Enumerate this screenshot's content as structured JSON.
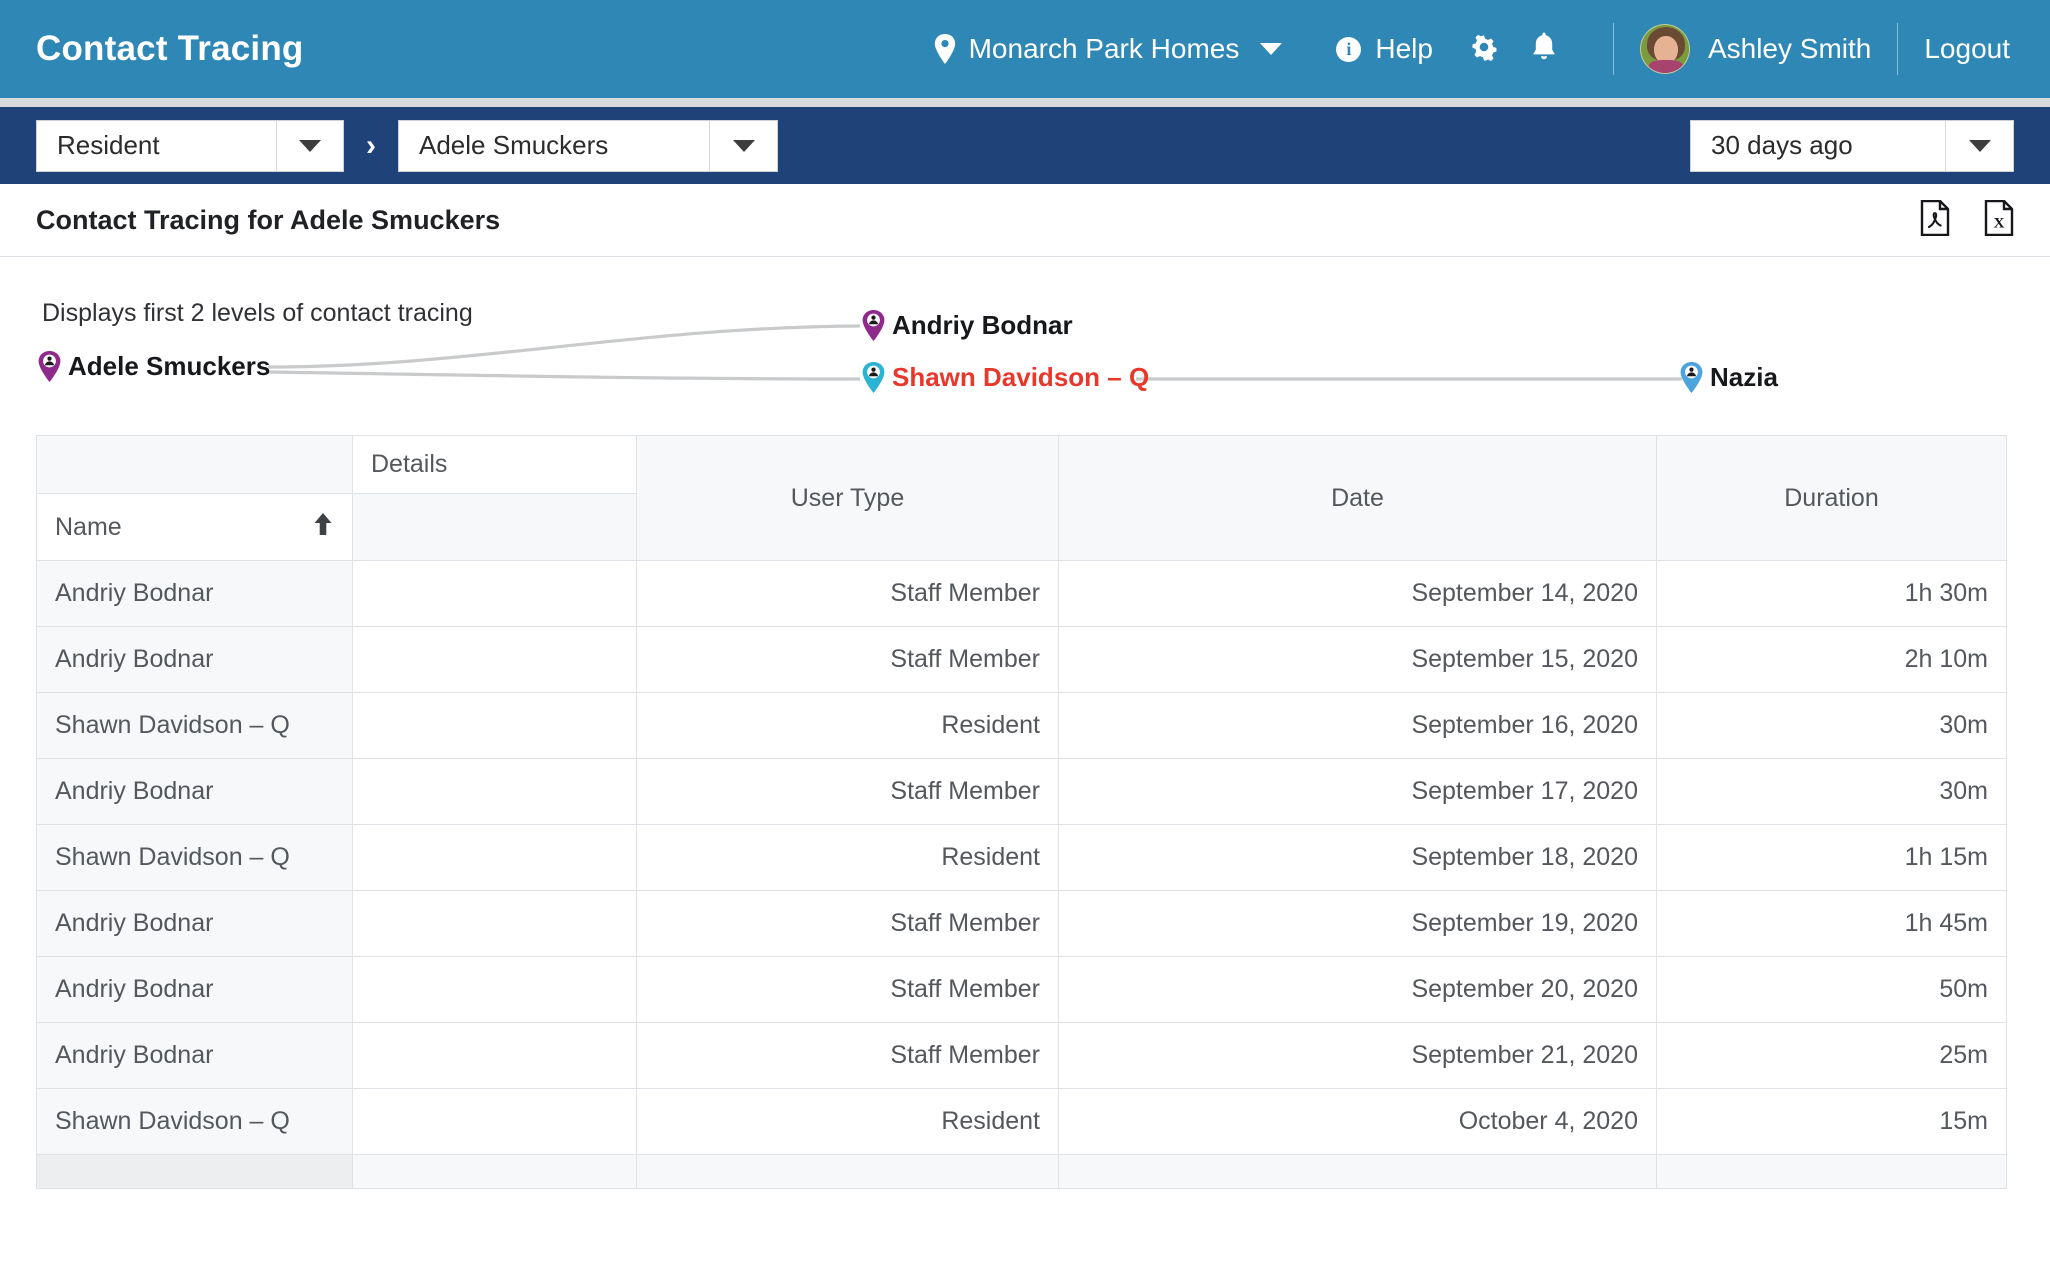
{
  "header": {
    "app_title": "Contact Tracing",
    "property": "Monarch Park Homes",
    "help_label": "Help",
    "user_name": "Ashley Smith",
    "logout_label": "Logout",
    "icons": {
      "location": "location-pin-icon",
      "info": "info-circle-icon",
      "settings": "gear-icon",
      "notifications": "bell-icon",
      "avatar": "user-avatar"
    },
    "colors": {
      "bar": "#2e87b4"
    }
  },
  "filter_bar": {
    "user_type": "Resident",
    "person": "Adele Smuckers",
    "separator": "›",
    "date_range": "30 days ago",
    "colors": {
      "bar": "#1f4378"
    }
  },
  "title_row": {
    "title": "Contact Tracing for Adele Smuckers",
    "export_pdf": "pdf-export-icon",
    "export_excel": "excel-export-icon"
  },
  "diagram": {
    "note": "Displays first 2 levels of contact tracing",
    "nodes": [
      {
        "id": "adele",
        "label": "Adele Smuckers",
        "pin_color": "#8e2a8b",
        "flagged": false
      },
      {
        "id": "andriy",
        "label": "Andriy Bodnar",
        "pin_color": "#8e2a8b",
        "flagged": false
      },
      {
        "id": "shawn",
        "label": "Shawn Davidson – Q",
        "pin_color": "#2bb3d4",
        "flagged": true
      },
      {
        "id": "nazia",
        "label": "Nazia",
        "pin_color": "#4da3dd",
        "flagged": false
      }
    ],
    "edges": [
      {
        "from": "adele",
        "to": "andriy"
      },
      {
        "from": "adele",
        "to": "shawn"
      },
      {
        "from": "shawn",
        "to": "nazia"
      }
    ],
    "flag_color": "#e8372b",
    "edge_color": "#c8cacc"
  },
  "table": {
    "group_header": "Details",
    "headers": {
      "name": "Name",
      "user_type": "User Type",
      "date": "Date",
      "duration": "Duration"
    },
    "sort": {
      "column": "Name",
      "direction": "ascending",
      "icon": "arrow-up-icon"
    },
    "rows": [
      {
        "name": "Andriy Bodnar",
        "user_type": "Staff Member",
        "date": "September 14, 2020",
        "duration": "1h 30m"
      },
      {
        "name": "Andriy Bodnar",
        "user_type": "Staff Member",
        "date": "September 15, 2020",
        "duration": "2h 10m"
      },
      {
        "name": "Shawn Davidson – Q",
        "user_type": "Resident",
        "date": "September 16, 2020",
        "duration": "30m"
      },
      {
        "name": "Andriy Bodnar",
        "user_type": "Staff Member",
        "date": "September 17, 2020",
        "duration": "30m"
      },
      {
        "name": "Shawn Davidson – Q",
        "user_type": "Resident",
        "date": "September 18, 2020",
        "duration": "1h 15m"
      },
      {
        "name": "Andriy Bodnar",
        "user_type": "Staff Member",
        "date": "September 19, 2020",
        "duration": "1h 45m"
      },
      {
        "name": "Andriy Bodnar",
        "user_type": "Staff Member",
        "date": "September 20, 2020",
        "duration": "50m"
      },
      {
        "name": "Andriy Bodnar",
        "user_type": "Staff Member",
        "date": "September 21, 2020",
        "duration": "25m"
      },
      {
        "name": "Shawn Davidson – Q",
        "user_type": "Resident",
        "date": "October 4, 2020",
        "duration": "15m"
      }
    ]
  }
}
